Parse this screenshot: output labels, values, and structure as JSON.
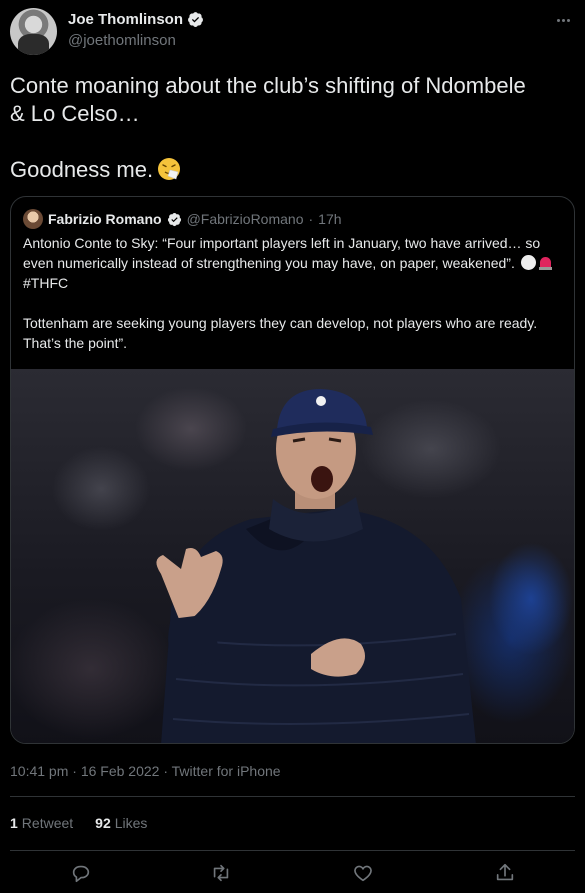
{
  "author": {
    "name": "Joe Thomlinson",
    "handle": "@joethomlinson"
  },
  "tweet": {
    "text_line1": "Conte moaning about the club’s shifting of Ndombele",
    "text_line2": "& Lo Celso…",
    "text_line3": "Goodness me.",
    "emoji": "sneezing-face-emoji"
  },
  "quoted_tweet": {
    "name": "Fabrizio Romano",
    "handle": "@FabrizioRomano",
    "age": "17h",
    "paragraph1": "Antonio Conte to Sky: “Four important players left in January, two have arrived… so even numerically instead of strengthening you may have, on paper, weakened”.",
    "hashtag": "#THFC",
    "paragraph2": "Tottenham are seeking young players they can develop, not players who are ready. That’s the point”.",
    "image": "photo of Antonio Conte in navy Tottenham cap and puffer jacket gesturing"
  },
  "meta": {
    "timestamp": "10:41 pm · 16 Feb 2022 · Twitter for iPhone"
  },
  "stats": {
    "retweets_count": "1",
    "retweets_label": "Retweet",
    "likes_count": "92",
    "likes_label": "Likes"
  },
  "icons": {
    "reply": "reply-icon",
    "retweet": "retweet-icon",
    "like": "heart-icon",
    "share": "share-icon"
  },
  "colors": {
    "background": "#000000",
    "text": "#e7e9ea",
    "secondary": "#71767b",
    "border": "#2f3336",
    "verified": "#1d9bf0"
  }
}
